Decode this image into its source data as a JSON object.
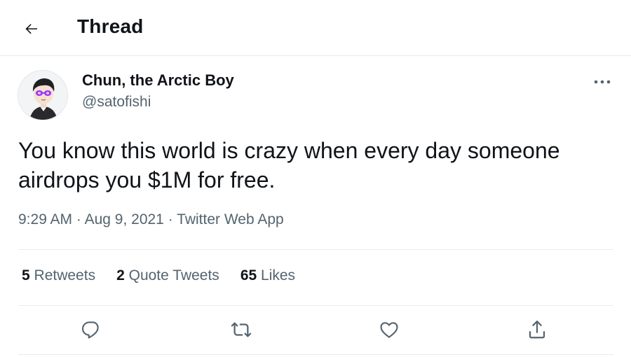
{
  "header": {
    "back_icon": "arrow-left-icon",
    "title": "Thread"
  },
  "author": {
    "name": "Chun, the Arctic Boy",
    "handle": "@satofishi",
    "more_icon": "more-horizontal-icon"
  },
  "tweet": {
    "text": "You know this world is crazy when every day someone airdrops you $1M for free."
  },
  "meta": {
    "time": "9:29 AM",
    "separator_1": "·",
    "date": "Aug 9, 2021",
    "separator_2": "·",
    "source": "Twitter Web App"
  },
  "stats": {
    "retweets_count": "5",
    "retweets_label": "Retweets",
    "quotes_count": "2",
    "quotes_label": "Quote Tweets",
    "likes_count": "65",
    "likes_label": "Likes"
  },
  "actions": {
    "reply_icon": "reply-icon",
    "retweet_icon": "retweet-icon",
    "like_icon": "heart-icon",
    "share_icon": "share-icon"
  },
  "colors": {
    "text_primary": "#0f1419",
    "text_secondary": "#536471",
    "divider": "#e6ecf0",
    "avatar_eyes": "#9b30ff"
  }
}
